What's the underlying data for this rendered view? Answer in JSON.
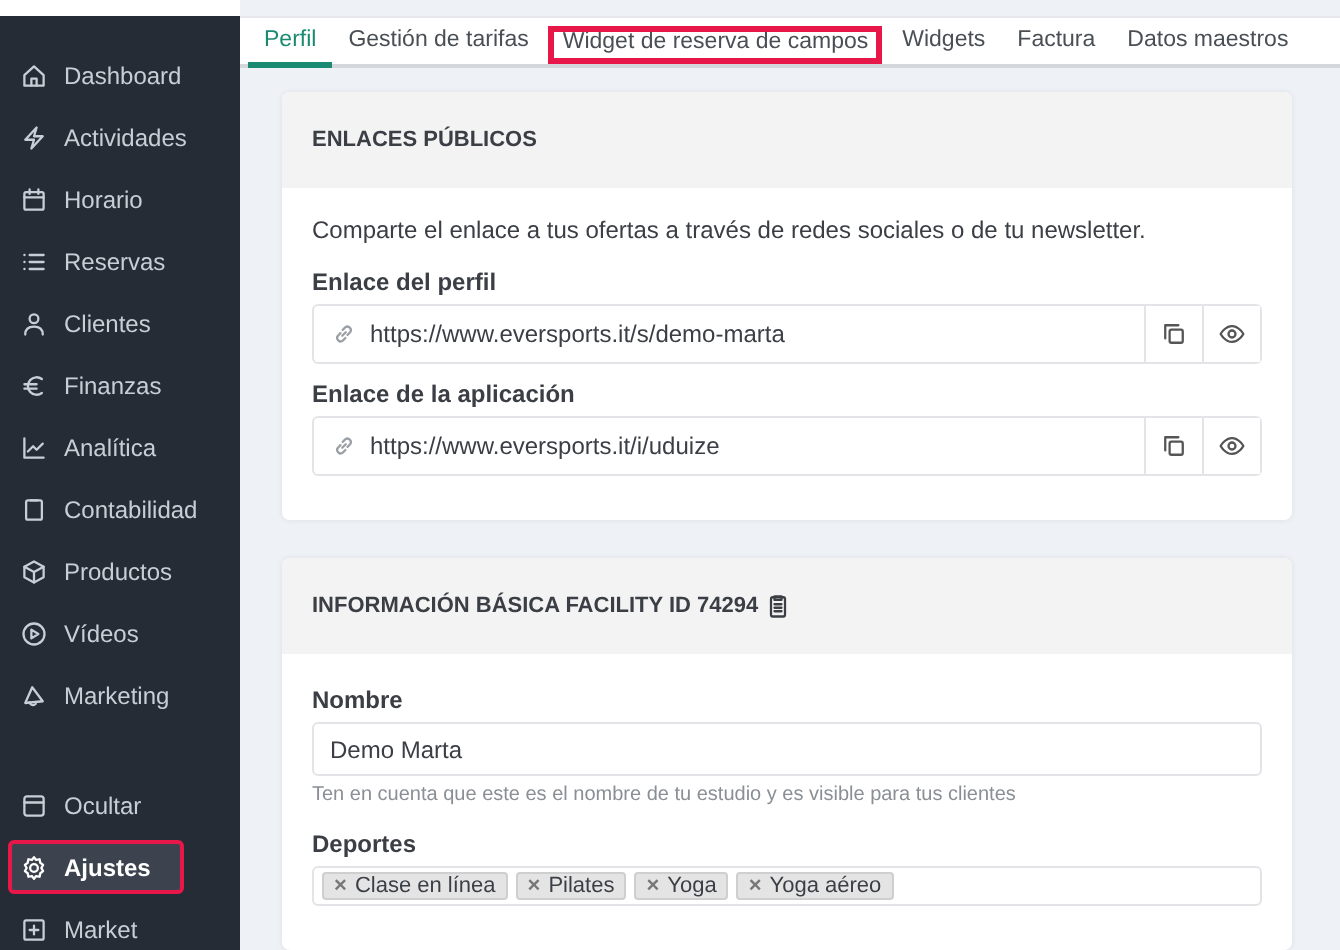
{
  "sidebar": {
    "nav_items": [
      {
        "label": "Dashboard",
        "selected": false,
        "highlighted": false
      },
      {
        "label": "Actividades",
        "selected": false,
        "highlighted": false
      },
      {
        "label": "Horario",
        "selected": false,
        "highlighted": false
      },
      {
        "label": "Reservas",
        "selected": false,
        "highlighted": false
      },
      {
        "label": "Clientes",
        "selected": false,
        "highlighted": false
      },
      {
        "label": "Finanzas",
        "selected": false,
        "highlighted": false
      },
      {
        "label": "Analítica",
        "selected": false,
        "highlighted": false
      },
      {
        "label": "Contabilidad",
        "selected": false,
        "highlighted": false
      },
      {
        "label": "Productos",
        "selected": false,
        "highlighted": false
      },
      {
        "label": "Vídeos",
        "selected": false,
        "highlighted": false
      },
      {
        "label": "Marketing",
        "selected": false,
        "highlighted": false
      }
    ],
    "bottom_items": [
      {
        "label": "Ocultar",
        "selected": false,
        "highlighted": false
      },
      {
        "label": "Ajustes",
        "selected": true,
        "highlighted": true
      },
      {
        "label": "Market",
        "selected": false,
        "highlighted": false
      }
    ]
  },
  "tabs": [
    {
      "label": "Perfil",
      "selected": true,
      "highlighted": false
    },
    {
      "label": "Gestión de tarifas",
      "selected": false,
      "highlighted": false
    },
    {
      "label": "Widget de reserva de campos",
      "selected": false,
      "highlighted": true
    },
    {
      "label": "Widgets",
      "selected": false,
      "highlighted": false
    },
    {
      "label": "Factura",
      "selected": false,
      "highlighted": false
    },
    {
      "label": "Datos maestros",
      "selected": false,
      "highlighted": false
    }
  ],
  "public_links": {
    "title": "ENLACES PÚBLICOS",
    "description": "Comparte el enlace a tus ofertas a través de redes sociales o de tu newsletter.",
    "links": [
      {
        "label": "Enlace del perfil",
        "url": "https://www.eversports.it/s/demo-marta"
      },
      {
        "label": "Enlace de la aplicación",
        "url": "https://www.eversports.it/i/uduize"
      }
    ]
  },
  "basic_info": {
    "title": "INFORMACIÓN BÁSICA FACILITY ID 74294",
    "name_label": "Nombre",
    "name_value": "Demo Marta",
    "name_hint": "Ten en cuenta que este es el nombre de tu estudio y es visible para tus clientes",
    "sports_label": "Deportes",
    "sports": [
      {
        "remove": "×",
        "label": "Clase en línea"
      },
      {
        "remove": "×",
        "label": "Pilates"
      },
      {
        "remove": "×",
        "label": "Yoga"
      },
      {
        "remove": "×",
        "label": "Yoga aéreo"
      }
    ]
  }
}
